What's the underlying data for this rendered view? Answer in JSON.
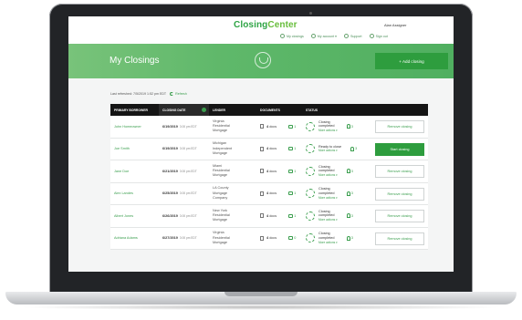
{
  "header": {
    "brand_part1": "Closing",
    "brand_part2": "Center",
    "user_name": "Alan Assigner",
    "nav": [
      {
        "label": "My closings",
        "icon": "home-icon"
      },
      {
        "label": "My account ▾",
        "icon": "account-icon"
      },
      {
        "label": "Support",
        "icon": "phone-icon"
      },
      {
        "label": "Sign out",
        "icon": "sign-out-icon"
      }
    ]
  },
  "band": {
    "title": "My Closings",
    "add_button": "+ Add closing"
  },
  "refresh": {
    "label": "Last refreshed: 7/5/2019 1:52 pm EDT",
    "link": "Refresh"
  },
  "table": {
    "headers": [
      "PRIMARY BORROWER",
      "CLOSING DATE",
      "LENDER",
      "DOCUMENTS",
      "STATUS"
    ],
    "rows": [
      {
        "borrower": "John Homeowner",
        "date": "6/19/2019",
        "time": "3:00 pm EDT",
        "lender": "Virginia\nResidential\nMortgage",
        "docs": "4",
        "docs_unit": "docs",
        "comments": "1",
        "status": "Closing\ncompleted",
        "more": "More actions ▾",
        "persons": "3",
        "action": "Remove closing",
        "primary": false
      },
      {
        "borrower": "Joe Smith",
        "date": "6/19/2019",
        "time": "3:00 pm EDT",
        "lender": "Michigan\nIndependent\nMortgage",
        "docs": "4",
        "docs_unit": "docs",
        "comments": "1",
        "status": "Ready to close",
        "more": "More actions ▾",
        "persons": "3",
        "action": "Start closing",
        "primary": true
      },
      {
        "borrower": "Jane Doe",
        "date": "6/21/2019",
        "time": "3:00 pm EDT",
        "lender": "Miami\nResidential\nMortgage",
        "docs": "4",
        "docs_unit": "docs",
        "comments": "1",
        "status": "Closing\ncompleted",
        "more": "More actions ▾",
        "persons": "3",
        "action": "Remove closing",
        "primary": false
      },
      {
        "borrower": "Alex Landes",
        "date": "6/25/2019",
        "time": "3:00 pm EDT",
        "lender": "LA County\nMortgage\nCompany",
        "docs": "4",
        "docs_unit": "docs",
        "comments": "1",
        "status": "Closing\ncompleted",
        "more": "More actions ▾",
        "persons": "3",
        "action": "Remove closing",
        "primary": false
      },
      {
        "borrower": "Albert Jones",
        "date": "6/26/2019",
        "time": "3:00 pm EDT",
        "lender": "New York\nResidential\nMortgage",
        "docs": "4",
        "docs_unit": "docs",
        "comments": "1",
        "status": "Closing\ncompleted",
        "more": "More actions ▾",
        "persons": "3",
        "action": "Remove closing",
        "primary": false
      },
      {
        "borrower": "Adriana Adams",
        "date": "6/27/2019",
        "time": "3:00 pm EDT",
        "lender": "Virginia\nResidential\nMortgage",
        "docs": "4",
        "docs_unit": "docs",
        "comments": "0",
        "status": "Closing\ncompleted",
        "more": "More actions ▾",
        "persons": "3",
        "action": "Remove closing",
        "primary": false
      }
    ]
  },
  "colors": {
    "brand_green": "#2e9d3e",
    "band_green": "#5fb86a",
    "header_dark": "#151515"
  }
}
